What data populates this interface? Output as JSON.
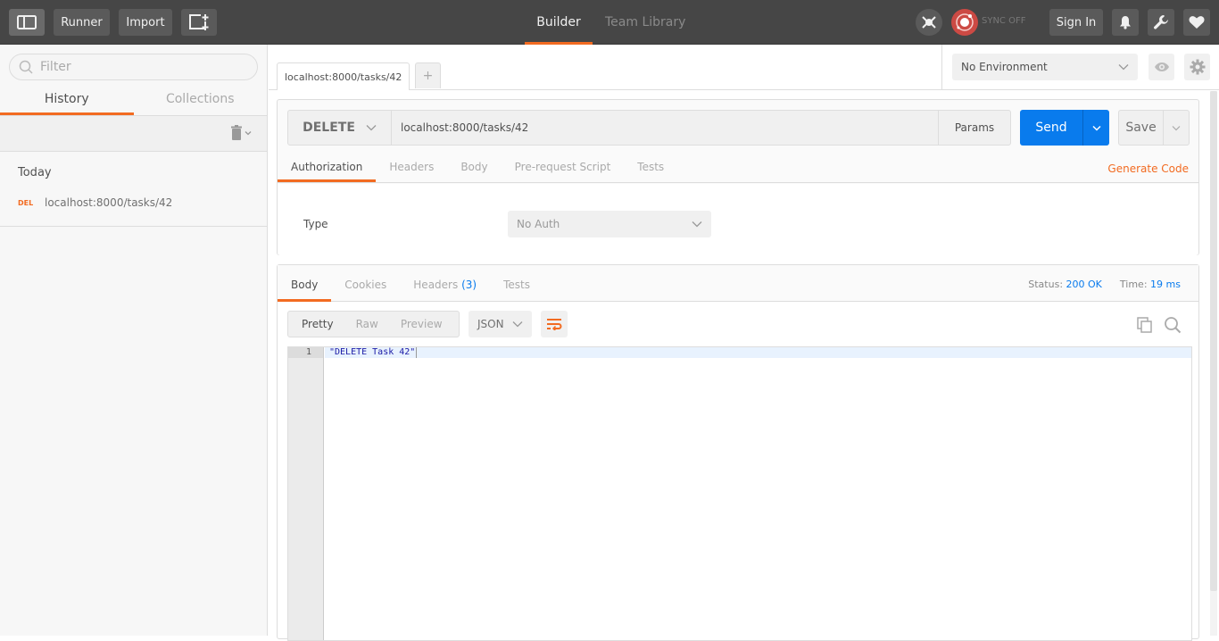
{
  "topbar": {
    "runner_label": "Runner",
    "import_label": "Import",
    "tabs": [
      {
        "label": "Builder",
        "active": true
      },
      {
        "label": "Team Library",
        "active": false
      }
    ],
    "sync_label": "SYNC OFF",
    "signin_label": "Sign In",
    "icons": [
      "sidebar-toggle-icon",
      "new-window-icon",
      "interceptor-icon",
      "sync-icon",
      "bell-icon",
      "wrench-icon",
      "heart-icon"
    ]
  },
  "sidebar": {
    "filter_placeholder": "Filter",
    "tabs": [
      {
        "label": "History",
        "active": true
      },
      {
        "label": "Collections",
        "active": false
      }
    ],
    "groups": [
      {
        "label": "Today",
        "items": [
          {
            "method": "DEL",
            "url": "localhost:8000/tasks/42"
          }
        ]
      }
    ]
  },
  "request_tabs": [
    {
      "label": "localhost:8000/tasks/42",
      "active": true
    }
  ],
  "add_tab_label": "+",
  "environment": {
    "selected": "No Environment"
  },
  "request": {
    "method": "DELETE",
    "url": "localhost:8000/tasks/42",
    "params_label": "Params",
    "send_label": "Send",
    "save_label": "Save",
    "tabs": [
      {
        "label": "Authorization",
        "active": true
      },
      {
        "label": "Headers",
        "active": false
      },
      {
        "label": "Body",
        "active": false
      },
      {
        "label": "Pre-request Script",
        "active": false
      },
      {
        "label": "Tests",
        "active": false
      }
    ],
    "generate_code_label": "Generate Code",
    "auth": {
      "type_label": "Type",
      "type_value": "No Auth"
    }
  },
  "response": {
    "tabs": [
      {
        "label": "Body",
        "active": true
      },
      {
        "label": "Cookies",
        "active": false
      },
      {
        "label": "Headers",
        "count": "(3)",
        "active": false
      },
      {
        "label": "Tests",
        "active": false
      }
    ],
    "status_label": "Status:",
    "status_value": "200 OK",
    "time_label": "Time:",
    "time_value": "19 ms",
    "views": [
      {
        "label": "Pretty",
        "active": true
      },
      {
        "label": "Raw",
        "active": false
      },
      {
        "label": "Preview",
        "active": false
      }
    ],
    "format": "JSON",
    "lines": [
      {
        "number": "1",
        "text": "\"DELETE Task 42\""
      }
    ]
  },
  "colors": {
    "accent": "#f26b21",
    "primary": "#097bed",
    "topbar_bg": "#464646",
    "sync_red": "#cc4a44"
  }
}
